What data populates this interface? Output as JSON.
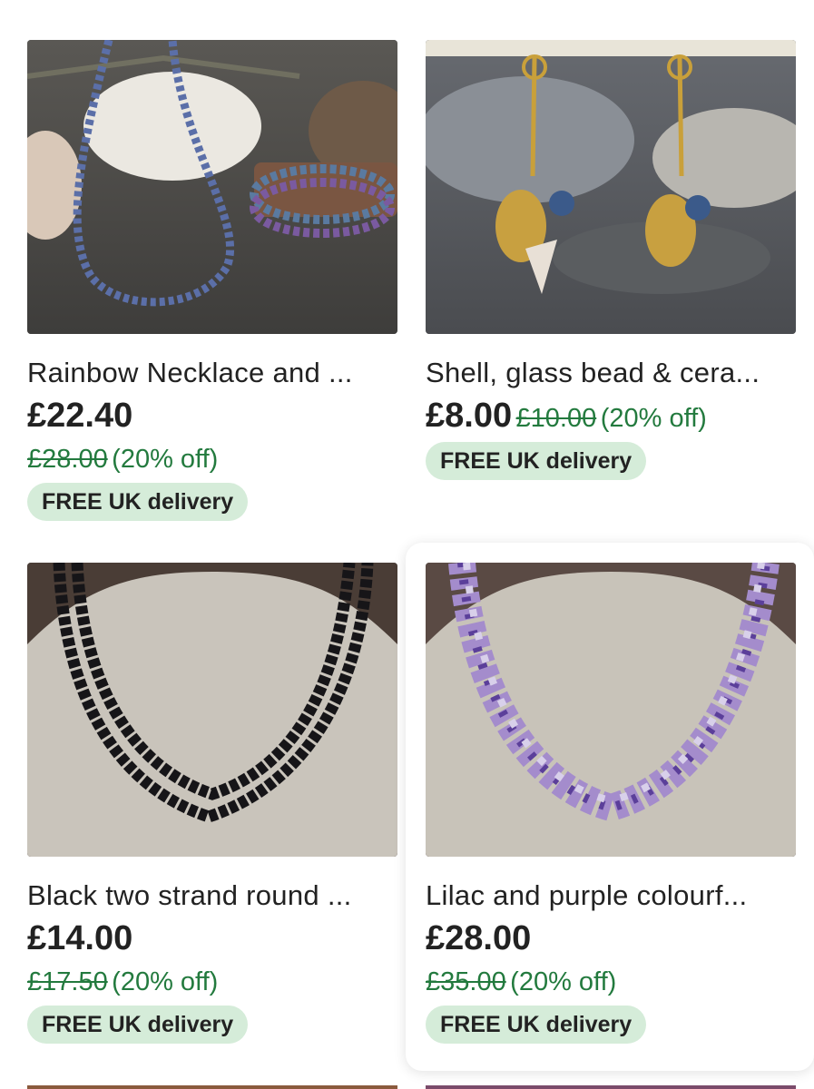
{
  "listings": [
    {
      "title": "Rainbow Necklace and ...",
      "price": "£22.40",
      "original_price": "£28.00",
      "discount": "(20% off)",
      "delivery": "FREE UK delivery"
    },
    {
      "title": "Shell, glass bead & cera...",
      "price": "£8.00",
      "original_price": "£10.00",
      "discount": "(20% off)",
      "delivery": "FREE UK delivery"
    },
    {
      "title": "Black two strand round ...",
      "price": "£14.00",
      "original_price": "£17.50",
      "discount": "(20% off)",
      "delivery": "FREE UK delivery"
    },
    {
      "title": "Lilac and purple colourf...",
      "price": "£28.00",
      "original_price": "£35.00",
      "discount": "(20% off)",
      "delivery": "FREE UK delivery"
    }
  ],
  "colors": {
    "sale_green": "#237a3e",
    "badge_bg": "#d5ecd9",
    "text": "#222222"
  }
}
